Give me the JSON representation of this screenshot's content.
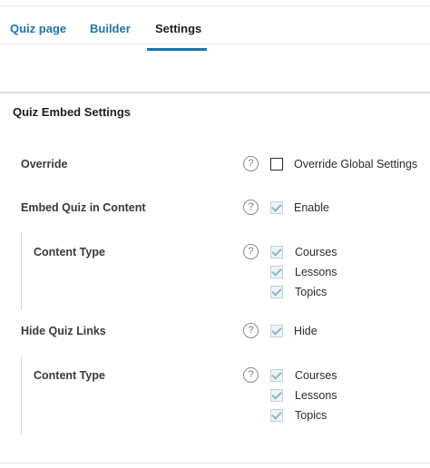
{
  "tabs": [
    {
      "label": "Quiz page"
    },
    {
      "label": "Builder"
    },
    {
      "label": "Settings"
    }
  ],
  "panel": {
    "title": "Quiz Embed Settings"
  },
  "override": {
    "label": "Override",
    "help": "?",
    "option": "Override Global Settings",
    "checked": false
  },
  "embed": {
    "label": "Embed Quiz in Content",
    "help": "?",
    "option": "Enable",
    "checked": true
  },
  "embed_content_type": {
    "label": "Content Type",
    "help": "?",
    "options": [
      {
        "label": "Courses",
        "checked": true
      },
      {
        "label": "Lessons",
        "checked": true
      },
      {
        "label": "Topics",
        "checked": true
      }
    ]
  },
  "hide_links": {
    "label": "Hide Quiz Links",
    "help": "?",
    "option": "Hide",
    "checked": true
  },
  "hide_content_type": {
    "label": "Content Type",
    "help": "?",
    "options": [
      {
        "label": "Courses",
        "checked": true
      },
      {
        "label": "Lessons",
        "checked": true
      },
      {
        "label": "Topics",
        "checked": true
      }
    ]
  }
}
